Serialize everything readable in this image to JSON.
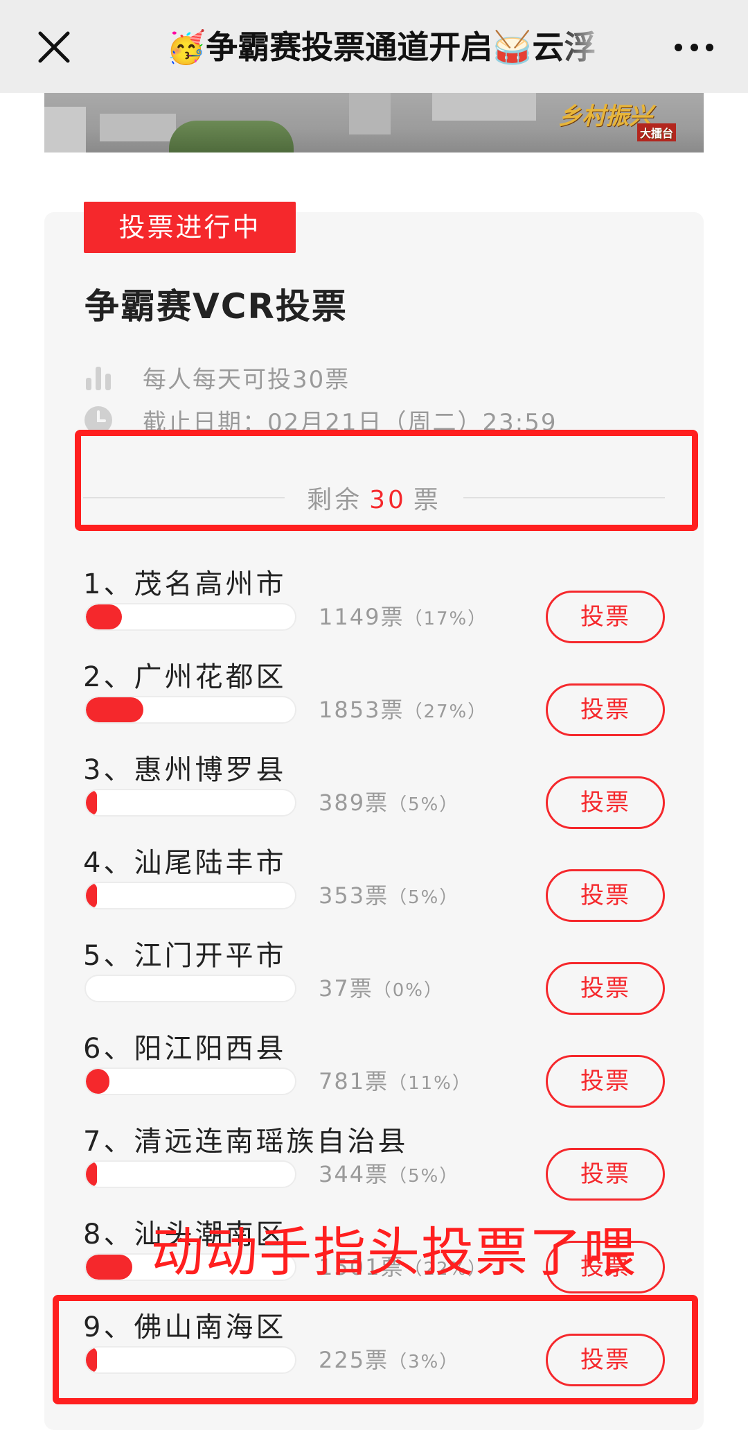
{
  "nav": {
    "title": "🥳争霸赛投票通道开启🥁云浮"
  },
  "banner": {
    "logo_text": "乡村振兴",
    "logo_sub": "大擂台"
  },
  "vote": {
    "status": "投票进行中",
    "title": "争霸赛VCR投票",
    "rule": "每人每天可投30票",
    "deadline": "截止日期：02月21日（周二）23:59",
    "remaining_prefix": "剩余",
    "remaining_count": "30",
    "remaining_suffix": "票",
    "button_label": "投票",
    "options": [
      {
        "label": "1、茂名高州市",
        "votes": "1149票",
        "pct": "（17%）",
        "share": 17
      },
      {
        "label": "2、广州花都区",
        "votes": "1853票",
        "pct": "（27%）",
        "share": 27
      },
      {
        "label": "3、惠州博罗县",
        "votes": "389票",
        "pct": "（5%）",
        "share": 5
      },
      {
        "label": "4、汕尾陆丰市",
        "votes": "353票",
        "pct": "（5%）",
        "share": 5
      },
      {
        "label": "5、江门开平市",
        "votes": "37票",
        "pct": "（0%）",
        "share": 0
      },
      {
        "label": "6、阳江阳西县",
        "votes": "781票",
        "pct": "（11%）",
        "share": 11
      },
      {
        "label": "7、清远连南瑶族自治县",
        "votes": "344票",
        "pct": "（5%）",
        "share": 5
      },
      {
        "label": "8、汕头潮南区",
        "votes": "1501票",
        "pct": "（22%）",
        "share": 22
      },
      {
        "label": "9、佛山南海区",
        "votes": "225票",
        "pct": "（3%）",
        "share": 3
      }
    ]
  },
  "annotation": {
    "overlay_text": "动动手指头投票了喂"
  },
  "colors": {
    "accent": "#f5282c",
    "annotation": "#ff1f1f"
  }
}
